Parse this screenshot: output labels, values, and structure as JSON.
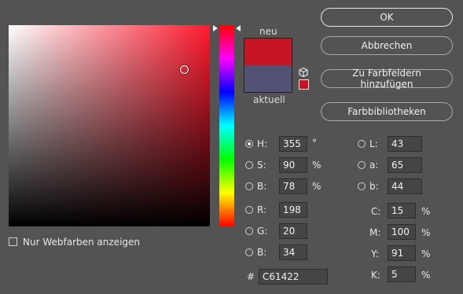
{
  "colors": {
    "new": "#C61422",
    "current": "#525274",
    "field_hue": "#ff1a2e",
    "gamut_warning": "#C61422"
  },
  "picker": {
    "hue_degrees": 355,
    "field_saturation_percent": 90,
    "field_brightness_percent": 78,
    "webcolors_checked": false
  },
  "labels": {
    "new": "neu",
    "current": "aktuell"
  },
  "buttons": {
    "ok": "OK",
    "cancel": "Abbrechen",
    "add_swatch": "Zu Farbfeldern hinzufügen",
    "libraries": "Farbbibliotheken"
  },
  "hsb": {
    "h": {
      "label": "H:",
      "value": "355",
      "unit": "°",
      "selected": true
    },
    "s": {
      "label": "S:",
      "value": "90",
      "unit": "%"
    },
    "b": {
      "label": "B:",
      "value": "78",
      "unit": "%"
    }
  },
  "rgb": {
    "r": {
      "label": "R:",
      "value": "198"
    },
    "g": {
      "label": "G:",
      "value": "20"
    },
    "b": {
      "label": "B:",
      "value": "34"
    }
  },
  "lab": {
    "l": {
      "label": "L:",
      "value": "43"
    },
    "a": {
      "label": "a:",
      "value": "65"
    },
    "b": {
      "label": "b:",
      "value": "44"
    }
  },
  "cmyk": {
    "c": {
      "label": "C:",
      "value": "15",
      "unit": "%"
    },
    "m": {
      "label": "M:",
      "value": "100",
      "unit": "%"
    },
    "y": {
      "label": "Y:",
      "value": "91",
      "unit": "%"
    },
    "k": {
      "label": "K:",
      "value": "5",
      "unit": "%"
    }
  },
  "hex": {
    "label": "#",
    "value": "C61422"
  },
  "webcolors": {
    "label": "Nur Webfarben anzeigen"
  },
  "icons": {
    "gamut": "cube-icon",
    "radio": "radio-button"
  }
}
